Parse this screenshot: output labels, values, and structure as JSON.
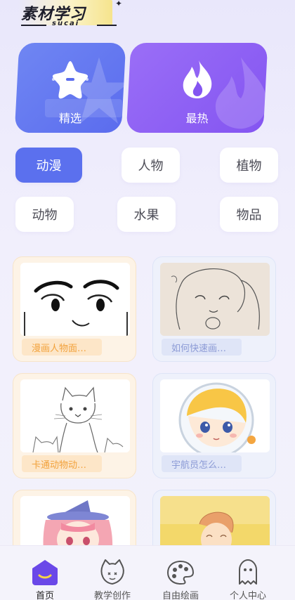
{
  "header": {
    "logo_title": "素材学习",
    "logo_sub": "sucai"
  },
  "features": [
    {
      "label": "精选",
      "icon": "star-icon",
      "color": "#5b6cee"
    },
    {
      "label": "最热",
      "icon": "flame-icon",
      "color": "#8455f1"
    }
  ],
  "categories": [
    {
      "label": "动漫",
      "active": true
    },
    {
      "label": "人物",
      "active": false
    },
    {
      "label": "植物",
      "active": false
    },
    {
      "label": "动物",
      "active": false
    },
    {
      "label": "水果",
      "active": false
    },
    {
      "label": "物品",
      "active": false
    }
  ],
  "materials": [
    {
      "title": "漫画人物面…",
      "theme": "warm"
    },
    {
      "title": "如何快速画…",
      "theme": "cool"
    },
    {
      "title": "卡通动物动…",
      "theme": "warm"
    },
    {
      "title": "宇航员怎么…",
      "theme": "cool"
    },
    {
      "title": "",
      "theme": "warm"
    },
    {
      "title": "",
      "theme": "cool"
    }
  ],
  "tabbar": [
    {
      "label": "首页",
      "icon": "home-icon",
      "active": true
    },
    {
      "label": "教学创作",
      "icon": "cat-icon",
      "active": false
    },
    {
      "label": "自由绘画",
      "icon": "palette-icon",
      "active": false
    },
    {
      "label": "个人中心",
      "icon": "ghost-icon",
      "active": false
    }
  ],
  "colors": {
    "accent": "#5b70ee",
    "purple": "#8455f1",
    "orange": "#f2a23c"
  }
}
